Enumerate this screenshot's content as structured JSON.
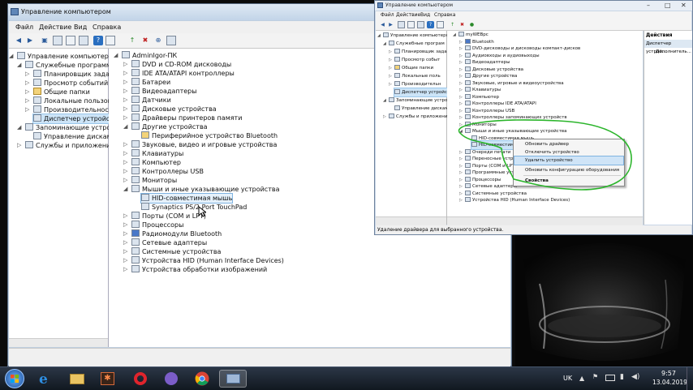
{
  "main_window": {
    "title": "Управление компьютером",
    "menu": [
      "Файл",
      "Действие",
      "Вид",
      "Справка"
    ],
    "left_tree": [
      "Управление компьютером (л",
      "Служебные программы",
      "Планировщик заданий",
      "Просмотр событий",
      "Общие папки",
      "Локальные пользовате",
      "Производительность",
      "Диспетчер устройств",
      "Запоминающие устройст",
      "Управление дисками",
      "Службы и приложения"
    ],
    "device_tree": [
      "AdminIgor-ПК",
      "DVD и CD-ROM дисководы",
      "IDE ATA/ATAPI контроллеры",
      "Батареи",
      "Видеоадаптеры",
      "Датчики",
      "Дисковые устройства",
      "Драйверы принтеров памяти",
      "Другие устройства",
      "Периферийное устройство Bluetooth",
      "Звуковые, видео и игровые устройства",
      "Клавиатуры",
      "Компьютер",
      "Контроллеры USB",
      "Мониторы",
      "Мыши и иные указывающие устройства",
      "HID-совместимая мышь",
      "Synaptics PS/2 Port TouchPad",
      "Порты (COM и LPT)",
      "Процессоры",
      "Радиомодули Bluetooth",
      "Сетевые адаптеры",
      "Системные устройства",
      "Устройства HID (Human Interface Devices)",
      "Устройства обработки изображений"
    ]
  },
  "second_window": {
    "title": "Управление компьютером",
    "menu": [
      "Файл",
      "Действие",
      "Вид",
      "Справка"
    ],
    "left_tree": [
      "Управление компьютером (л",
      "Служебные програм",
      "Планировщик задани",
      "Просмотр событ",
      "Общие папки",
      "Локальные поль",
      "Производительн",
      "Диспетчер устройств",
      "Запоминающие устро",
      "Управление дисками",
      "Службы и приложения"
    ],
    "device_tree": [
      "myWEBpc",
      "Bluetooth",
      "DVD-дисководы и дисководы компакт-дисков",
      "Аудиовходы и аудиовыходы",
      "Видеоадаптеры",
      "Дисковые устройства",
      "Другие устройства",
      "Звуковые, игровые и видеоустройства",
      "Клавиатуры",
      "Компьютер",
      "Контроллеры IDE ATA/ATAPI",
      "Контроллеры USB",
      "Контроллеры запоминающих устройств",
      "Мониторы",
      "Мыши и иные указывающие устройства",
      "HID-совместимая мышь",
      "HID-совместимая мышь",
      "Очереди печати",
      "Переносные устройства",
      "Порты (COM и LPT)",
      "Программные устройства",
      "Процессоры",
      "Сетевые адаптеры",
      "Системные устройства",
      "Устройства HID (Human Interface Devices)"
    ],
    "actions_header": "Действия",
    "actions": [
      "Диспетчер устрой...",
      "Дополнитель..."
    ],
    "status": "Удаление драйвера для выбранного устройства.",
    "context_menu": [
      "Обновить драйвер",
      "Отключить устройство",
      "Удалить устройство",
      "Обновить конфигурацию оборудования",
      "Свойства"
    ]
  },
  "taskbar": {
    "lang": "UK",
    "time": "9:57",
    "date": "13.04.2019"
  },
  "colors": {
    "highlight_circle": "#2bb52b",
    "selection": "#cce4f7",
    "taskbar": "#1b2430"
  },
  "icons": [
    "windows-start-icon",
    "ie-icon",
    "folder-icon",
    "app-icon",
    "opera-icon",
    "viber-icon",
    "chrome-icon",
    "computer-management-icon"
  ]
}
